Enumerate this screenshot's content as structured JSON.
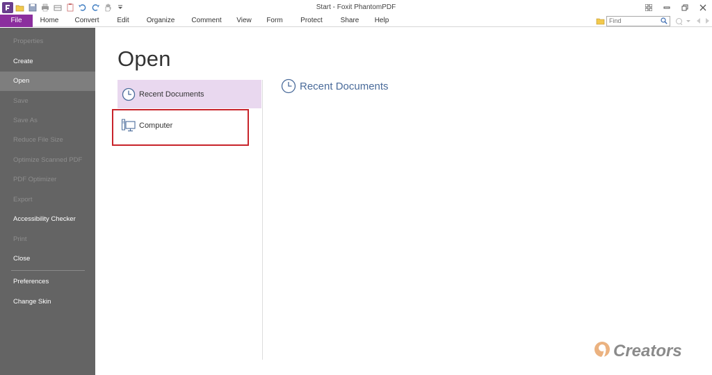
{
  "window": {
    "title": "Start - Foxit PhantomPDF"
  },
  "quick_access_icons": [
    "app-logo-icon",
    "open-folder-icon",
    "save-icon",
    "print-icon",
    "scan-icon",
    "paste-icon",
    "undo-icon",
    "redo-icon",
    "hand-tool-icon",
    "customize-dropdown-icon"
  ],
  "menu": {
    "items": [
      "File",
      "Home",
      "Convert",
      "Edit",
      "Organize",
      "Comment",
      "View",
      "Form",
      "Protect",
      "Share",
      "Help"
    ]
  },
  "find": {
    "placeholder": "Find"
  },
  "sidebar": {
    "items": [
      {
        "label": "Properties",
        "enabled": false
      },
      {
        "label": "Create",
        "enabled": true
      },
      {
        "label": "Open",
        "enabled": true,
        "active": true
      },
      {
        "label": "Save",
        "enabled": false
      },
      {
        "label": "Save As",
        "enabled": false
      },
      {
        "label": "Reduce File Size",
        "enabled": false
      },
      {
        "label": "Optimize Scanned PDF",
        "enabled": false
      },
      {
        "label": "PDF Optimizer",
        "enabled": false
      },
      {
        "label": "Export",
        "enabled": false
      },
      {
        "label": "Accessibility Checker",
        "enabled": true
      },
      {
        "label": "Print",
        "enabled": false
      },
      {
        "label": "Close",
        "enabled": true
      },
      {
        "label": "Preferences",
        "enabled": true
      },
      {
        "label": "Change Skin",
        "enabled": true
      }
    ]
  },
  "main": {
    "title": "Open",
    "options": [
      {
        "label": "Recent Documents",
        "icon": "clock-icon",
        "selected": true
      },
      {
        "label": "Computer",
        "icon": "computer-icon",
        "selected": false
      }
    ],
    "section_heading": "Recent Documents"
  },
  "watermark": {
    "text": "Creators"
  },
  "colors": {
    "file_tab": "#8b2e9e",
    "sidebar": "#646464",
    "sidebar_active": "#7e7e7e",
    "selected_option": "#e9d8ef",
    "highlight": "#c8232a",
    "heading": "#4a6b9a"
  }
}
